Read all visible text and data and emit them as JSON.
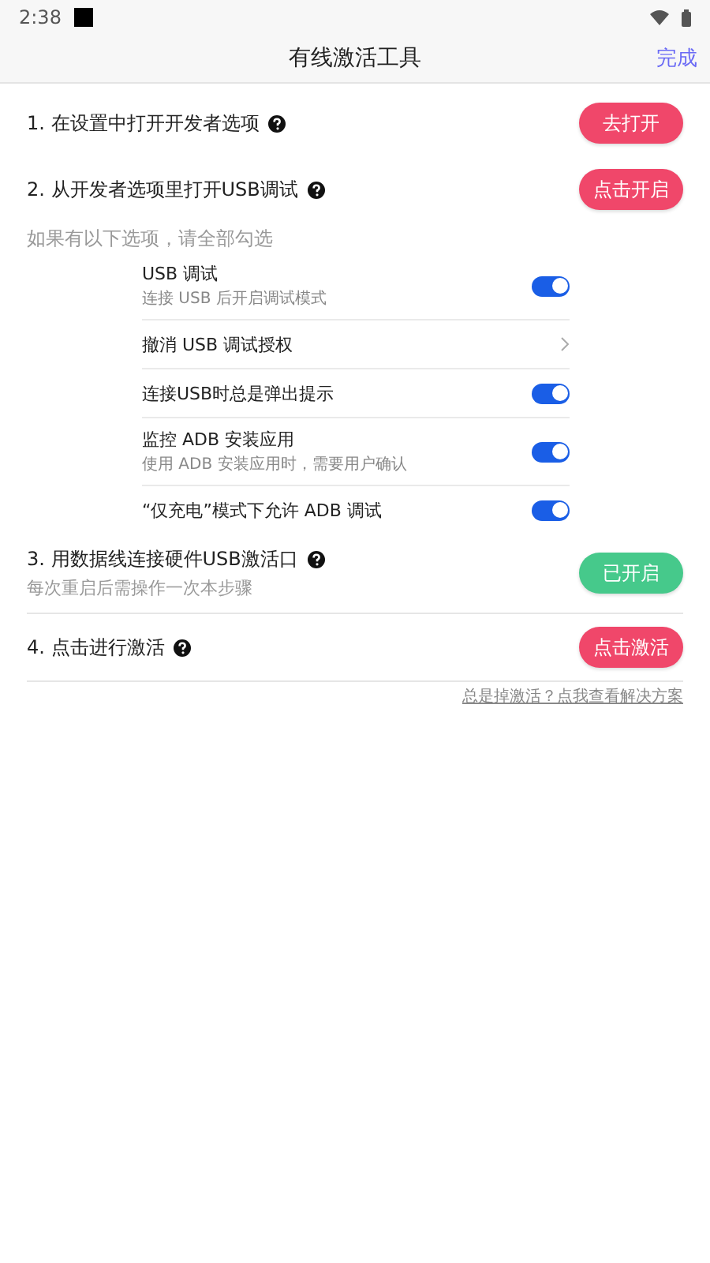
{
  "status_bar": {
    "time": "2:38"
  },
  "header": {
    "title": "有线激活工具",
    "action": "完成"
  },
  "steps": [
    {
      "title": "1. 在设置中打开开发者选项",
      "button": {
        "label": "去打开",
        "kind": "action"
      }
    },
    {
      "title": "2. 从开发者选项里打开USB调试",
      "button": {
        "label": "点击开启",
        "kind": "action"
      },
      "note": "如果有以下选项，请全部勾选",
      "settings": [
        {
          "kind": "toggle",
          "title": "USB 调试",
          "subtitle": "连接 USB 后开启调试模式",
          "on": true
        },
        {
          "kind": "link",
          "title": "撤消 USB 调试授权"
        },
        {
          "kind": "toggle",
          "title": "连接USB时总是弹出提示",
          "on": true
        },
        {
          "kind": "toggle",
          "title": "监控 ADB 安装应用",
          "subtitle": "使用 ADB 安装应用时，需要用户确认",
          "on": true
        },
        {
          "kind": "toggle",
          "title": "“仅充电”模式下允许 ADB 调试",
          "on": true
        }
      ]
    },
    {
      "title": "3. 用数据线连接硬件USB激活口",
      "subtitle": "每次重启后需操作一次本步骤",
      "button": {
        "label": "已开启",
        "kind": "done"
      }
    },
    {
      "title": "4. 点击进行激活",
      "button": {
        "label": "点击激活",
        "kind": "action"
      }
    }
  ],
  "help_link": "总是掉激活？点我查看解决方案"
}
